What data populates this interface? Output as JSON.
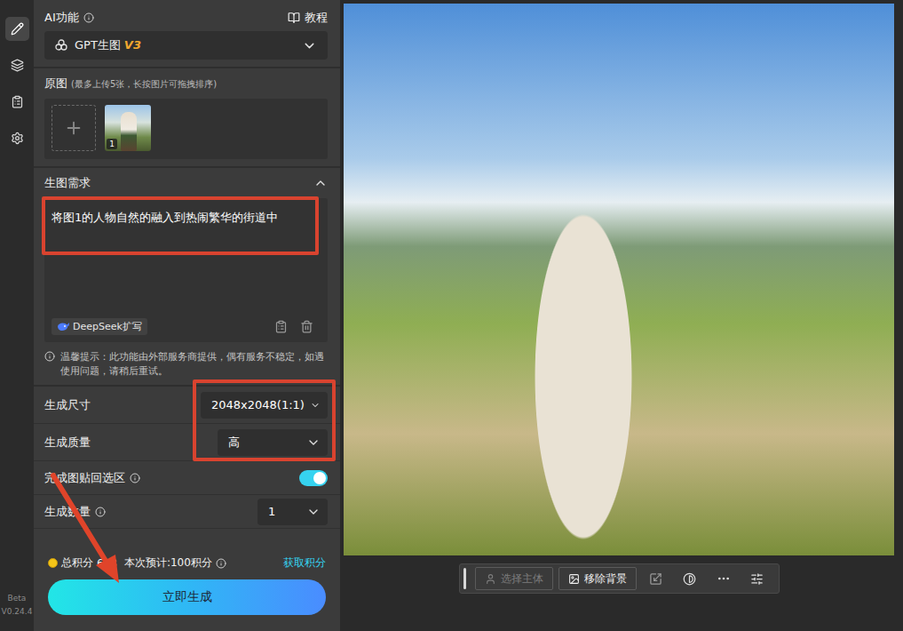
{
  "rail_items": [
    {
      "selected": true
    },
    {
      "selected": false
    },
    {
      "selected": false
    },
    {
      "selected": false
    }
  ],
  "version": {
    "beta": "Beta",
    "number": "V0.24.4"
  },
  "panel": {
    "title": "AI功能",
    "tutorial": "教程",
    "model": {
      "name": "GPT生图",
      "version": "V3"
    },
    "source": {
      "label": "原图",
      "hint": "(最多上传5张，长按图片可拖拽排序)",
      "images": [
        {
          "index": "1"
        }
      ]
    },
    "prompt": {
      "label": "生图需求",
      "expanded": true,
      "value": "将图1的人物自然的融入到热闹繁华的街道中",
      "highlighted": true,
      "expand_button": "DeepSeek扩写"
    },
    "notice": "温馨提示：此功能由外部服务商提供，偶有服务不稳定，如遇使用问题，请稍后重试。",
    "settings": [
      {
        "kind": "select",
        "label": "生成尺寸",
        "info": false,
        "value": "2048x2048(1:1)",
        "highlighted": true
      },
      {
        "kind": "select",
        "label": "生成质量",
        "info": false,
        "value": "高",
        "highlighted": true
      },
      {
        "kind": "toggle",
        "label": "完成图贴回选区",
        "info": true,
        "on": true,
        "highlighted": false
      },
      {
        "kind": "select",
        "label": "生成数量",
        "info": true,
        "value": "1",
        "highlighted": false
      }
    ],
    "points": {
      "total_label": "总积分",
      "total": "608",
      "estimate": "本次预计:100积分",
      "get": "获取积分"
    },
    "generate": "立即生成",
    "arrow_to_generate": true
  },
  "canvas": {
    "toolbar": [
      {
        "label": "选择主体",
        "disabled": true
      },
      {
        "label": "移除背景",
        "disabled": false
      }
    ]
  }
}
